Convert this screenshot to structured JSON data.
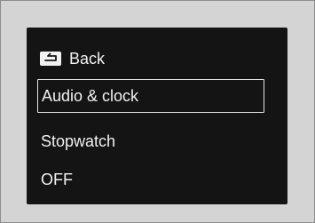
{
  "menu": {
    "items": [
      {
        "label": "Back",
        "icon": "back-icon",
        "selected": false
      },
      {
        "label": "Audio & clock",
        "selected": true
      },
      {
        "label": "Stopwatch",
        "selected": false
      },
      {
        "label": "OFF",
        "selected": false
      }
    ]
  },
  "colors": {
    "frame_background": "#d4d4d4",
    "screen_background": "#141414",
    "text": "#f2f2f2",
    "selection_border": "#e6e6e6"
  }
}
